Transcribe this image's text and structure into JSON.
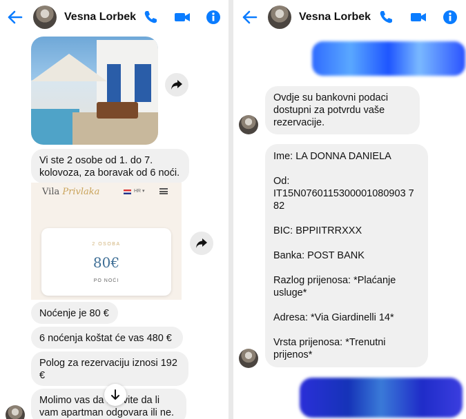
{
  "colors": {
    "accent": "#0a7cff",
    "bubble": "#f0f0f0"
  },
  "left": {
    "header": {
      "name": "Vesna Lorbek"
    },
    "messages": [
      "Vi ste 2 osobe od 1. do 7. kolovoza, za boravak od 6 noći.",
      "Noćenje je 80 €",
      "6 noćenja koštat će vas 480 €",
      "Polog za rezervaciju iznosi 192 €",
      "Molimo vas da       n javite da li vam apartman odgovara ili ne."
    ],
    "screenshot": {
      "brand_1": "Vila",
      "brand_2": "Privlaka",
      "lang": "HR ▾",
      "caption": "2 OSOBA",
      "price": "80€",
      "per": "PO NOĆI"
    }
  },
  "right": {
    "header": {
      "name": "Vesna Lorbek"
    },
    "message_intro": "Ovdje su bankovni podaci dostupni za potvrdu vaše rezervacije.",
    "bank": {
      "ime": "Ime: LA DONNA DANIELA",
      "od_label": "Od:",
      "iban_1": "IT15N0760115300001080903 7",
      "iban_2": "82",
      "bic": "BIC: BPPIITRRXXX",
      "banka": "Banka: POST BANK",
      "razlog_1": "Razlog prijenosa: *Plaćanje",
      "razlog_2": "usluge*",
      "adresa": "Adresa: *Via Giardinelli 14*",
      "vrsta_1": "Vrsta prijenosa: *Trenutni",
      "vrsta_2": "prijenos*"
    }
  },
  "icons": [
    "back-arrow-icon",
    "phone-icon",
    "video-icon",
    "info-icon",
    "share-icon",
    "chevron-down-icon"
  ]
}
